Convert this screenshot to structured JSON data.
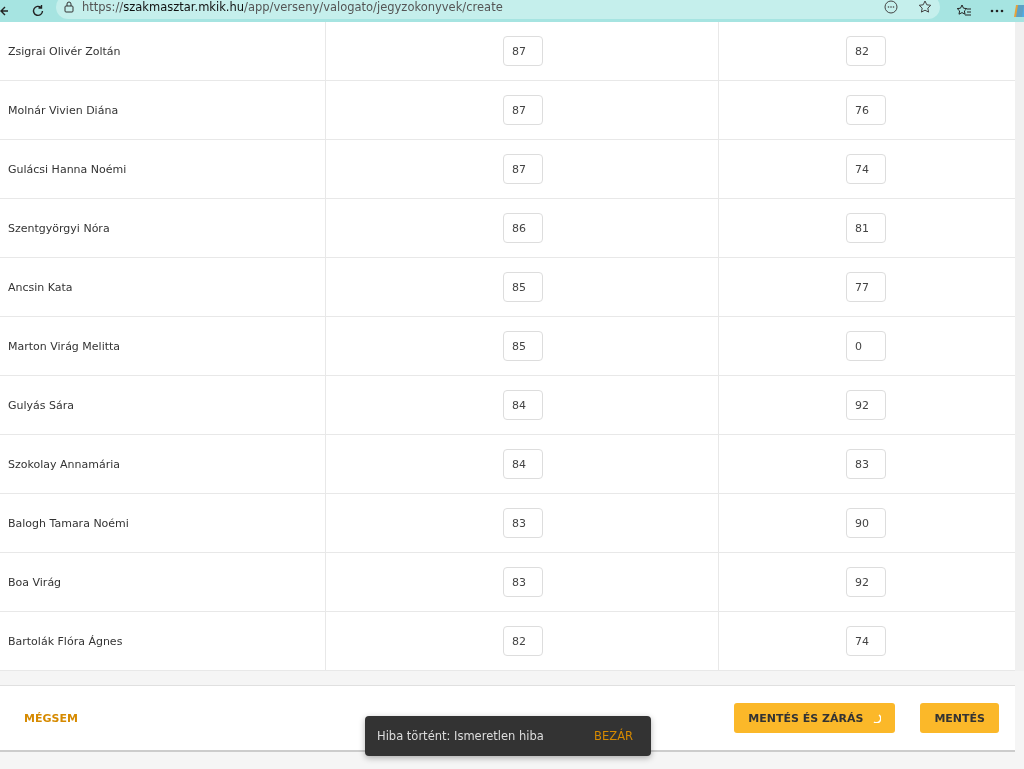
{
  "browser": {
    "url": "https://**szakmasztar.mkik.hu**/app/verseny/valogato/jegyzokonyvek/create"
  },
  "table": {
    "rows": [
      {
        "name": "Zsigrai Olivér Zoltán",
        "score_1": "87",
        "score_2": "82"
      },
      {
        "name": "Molnár Vivien Diána",
        "score_1": "87",
        "score_2": "76"
      },
      {
        "name": "Gulácsi Hanna Noémi",
        "score_1": "87",
        "score_2": "74"
      },
      {
        "name": "Szentgyörgyi Nóra",
        "score_1": "86",
        "score_2": "81"
      },
      {
        "name": "Ancsin Kata",
        "score_1": "85",
        "score_2": "77"
      },
      {
        "name": "Marton Virág Melitta",
        "score_1": "85",
        "score_2": "0"
      },
      {
        "name": "Gulyás Sára",
        "score_1": "84",
        "score_2": "92"
      },
      {
        "name": "Szokolay Annamária",
        "score_1": "84",
        "score_2": "83"
      },
      {
        "name": "Balogh Tamara Noémi",
        "score_1": "83",
        "score_2": "90"
      },
      {
        "name": "Boa Virág",
        "score_1": "83",
        "score_2": "92"
      },
      {
        "name": "Bartolák Flóra Ágnes",
        "score_1": "82",
        "score_2": "74"
      }
    ]
  },
  "footer": {
    "cancel": "MÉGSEM",
    "save_close": "MENTÉS ÉS ZÁRÁS",
    "save_close_loading": true,
    "save": "MENTÉS"
  },
  "toast": {
    "message": "Hiba történt: Ismeretlen hiba",
    "action": "BEZÁR"
  }
}
